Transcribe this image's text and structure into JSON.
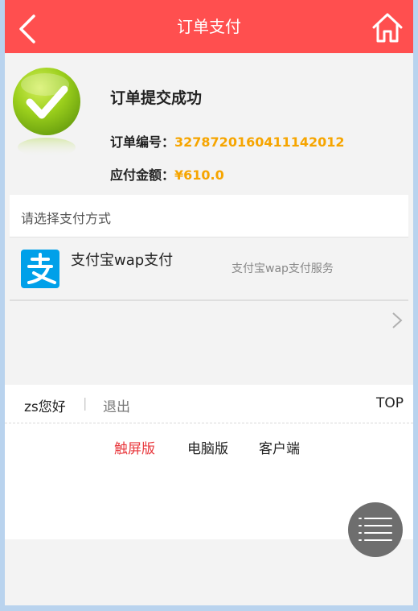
{
  "header": {
    "title": "订单支付",
    "back_icon": "back-arrow-icon",
    "home_icon": "home-icon"
  },
  "order": {
    "status_title": "订单提交成功",
    "number_label": "订单编号：",
    "number_value": "3278720160411142012",
    "amount_label": "应付金额：",
    "amount_value": "¥610.0"
  },
  "payment": {
    "section_title": "请选择支付方式",
    "methods": [
      {
        "name": "支付宝wap支付",
        "description": "支付宝wap支付服务",
        "icon": "alipay-icon"
      }
    ]
  },
  "footer": {
    "user_greeting": "zs您好",
    "separator": "|",
    "logout": "退出",
    "top": "TOP",
    "links": [
      {
        "label": "触屏版",
        "active": true
      },
      {
        "label": "电脑版",
        "active": false
      },
      {
        "label": "客户端",
        "active": false
      }
    ]
  },
  "colors": {
    "header": "#ff4f4f",
    "accent": "#f6a500",
    "active_link": "#e8383d",
    "alipay": "#00a0e9"
  }
}
